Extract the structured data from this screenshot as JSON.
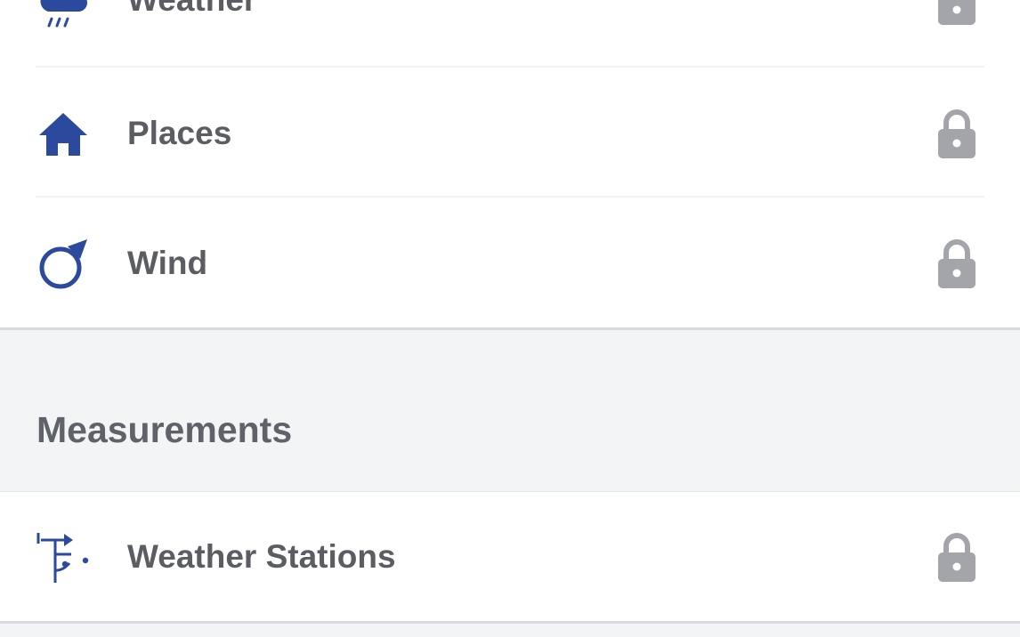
{
  "layers": {
    "items": [
      {
        "label": "Weather",
        "icon": "weather-rain-icon",
        "locked": true
      },
      {
        "label": "Places",
        "icon": "home-icon",
        "locked": true
      },
      {
        "label": "Wind",
        "icon": "wind-direction-icon",
        "locked": true
      }
    ]
  },
  "measurements": {
    "title": "Measurements",
    "items": [
      {
        "label": "Weather Stations",
        "icon": "weather-station-icon",
        "locked": true
      }
    ]
  },
  "colors": {
    "icon": "#2b4a9e",
    "label": "#5b5d63",
    "lock": "#a3a5ab",
    "section_bg": "#f3f4f6"
  }
}
